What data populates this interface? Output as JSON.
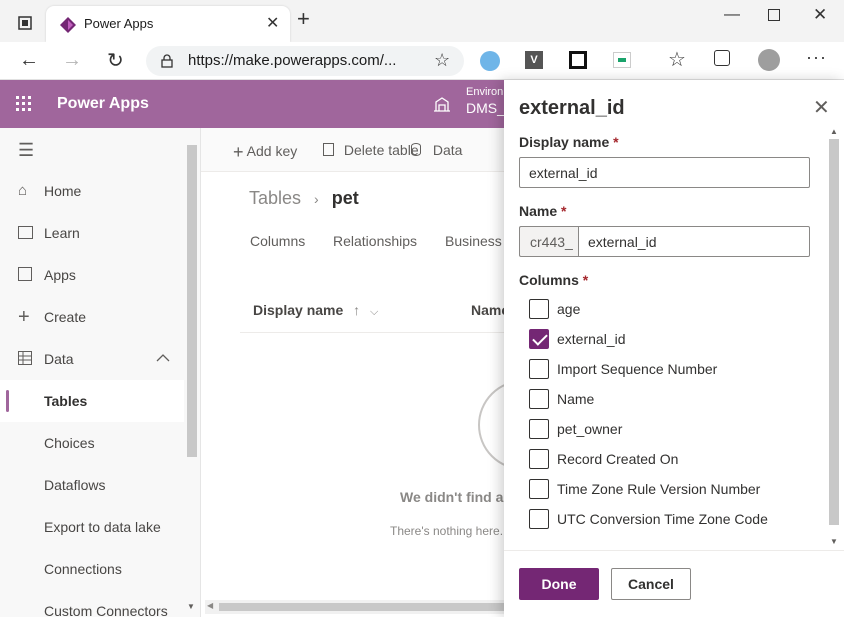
{
  "browser": {
    "tab_title": "Power Apps",
    "url": "https://make.powerapps.com/...",
    "icons": [
      "back-icon",
      "forward-icon",
      "refresh-icon",
      "lock-icon",
      "favorite-add-icon",
      "extension-icon",
      "collections-icon",
      "profile-icon",
      "more-icon"
    ]
  },
  "header": {
    "app_title": "Power Apps",
    "env_label": "Environ",
    "env_name": "DMS_"
  },
  "sidebar": {
    "items": [
      {
        "label": "Home",
        "icon": "home-icon"
      },
      {
        "label": "Learn",
        "icon": "book-icon"
      },
      {
        "label": "Apps",
        "icon": "apps-icon"
      },
      {
        "label": "Create",
        "icon": "plus-icon"
      },
      {
        "label": "Data",
        "icon": "table-icon"
      },
      {
        "label": "Tables"
      },
      {
        "label": "Choices"
      },
      {
        "label": "Dataflows"
      },
      {
        "label": "Export to data lake"
      },
      {
        "label": "Connections"
      },
      {
        "label": "Custom Connectors"
      }
    ]
  },
  "commandbar": {
    "add_key": "Add key",
    "delete_table": "Delete table",
    "data": "Data"
  },
  "main": {
    "breadcrumb_root": "Tables",
    "breadcrumb_current": "pet",
    "tabs": [
      "Columns",
      "Relationships",
      "Business"
    ],
    "col_display_name": "Display name",
    "col_name": "Name",
    "empty_title": "We didn't find a",
    "empty_sub": "There's nothing here."
  },
  "panel": {
    "title": "external_id",
    "display_name_label": "Display name",
    "display_name_value": "external_id",
    "name_label": "Name",
    "name_prefix": "cr443_",
    "name_value": "external_id",
    "columns_label": "Columns",
    "required_marker": "*",
    "columns": [
      {
        "label": "age",
        "checked": false
      },
      {
        "label": "external_id",
        "checked": true
      },
      {
        "label": "Import Sequence Number",
        "checked": false
      },
      {
        "label": "Name",
        "checked": false
      },
      {
        "label": "pet_owner",
        "checked": false
      },
      {
        "label": "Record Created On",
        "checked": false
      },
      {
        "label": "Time Zone Rule Version Number",
        "checked": false
      },
      {
        "label": "UTC Conversion Time Zone Code",
        "checked": false
      }
    ],
    "done_label": "Done",
    "cancel_label": "Cancel"
  },
  "colors": {
    "brand": "#a0669c",
    "primary_button": "#742774"
  }
}
